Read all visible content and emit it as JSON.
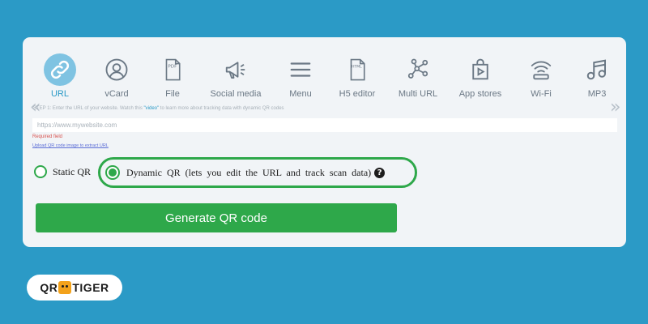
{
  "tabs": [
    {
      "label": "URL",
      "icon": "link-icon",
      "active": true
    },
    {
      "label": "vCard",
      "icon": "user-icon"
    },
    {
      "label": "File",
      "icon": "pdf-file-icon"
    },
    {
      "label": "Social media",
      "icon": "megaphone-icon"
    },
    {
      "label": "Menu",
      "icon": "menu-icon"
    },
    {
      "label": "H5 editor",
      "icon": "html-file-icon"
    },
    {
      "label": "Multi URL",
      "icon": "network-icon"
    },
    {
      "label": "App stores",
      "icon": "app-store-bag-icon"
    },
    {
      "label": "Wi-Fi",
      "icon": "wifi-icon"
    },
    {
      "label": "MP3",
      "icon": "music-icon"
    }
  ],
  "nav": {
    "prev": "«",
    "next": "»"
  },
  "step": {
    "text_before": "STEP 1: Enter the URL of your website.",
    "text_watch": " Watch this ",
    "video_link": "\"video\"",
    "text_after": " to learn more about tracking data with dynamic QR codes"
  },
  "url_input": {
    "placeholder": "https://www.mywebsite.com",
    "value": ""
  },
  "required_text": "Required field",
  "upload_link": "Upload QR code image to extract URL",
  "options": {
    "static_label": "Static QR",
    "dynamic_label": "Dynamic QR (lets you edit the URL and track scan data)",
    "help": "?",
    "selected": "dynamic"
  },
  "generate_button": "Generate QR code",
  "logo": {
    "left": "QR",
    "right": "TIGER"
  },
  "colors": {
    "background": "#2b9ac6",
    "accent": "#2ea84a",
    "card": "#f1f4f7",
    "active_tab": "#7fc3e2"
  }
}
